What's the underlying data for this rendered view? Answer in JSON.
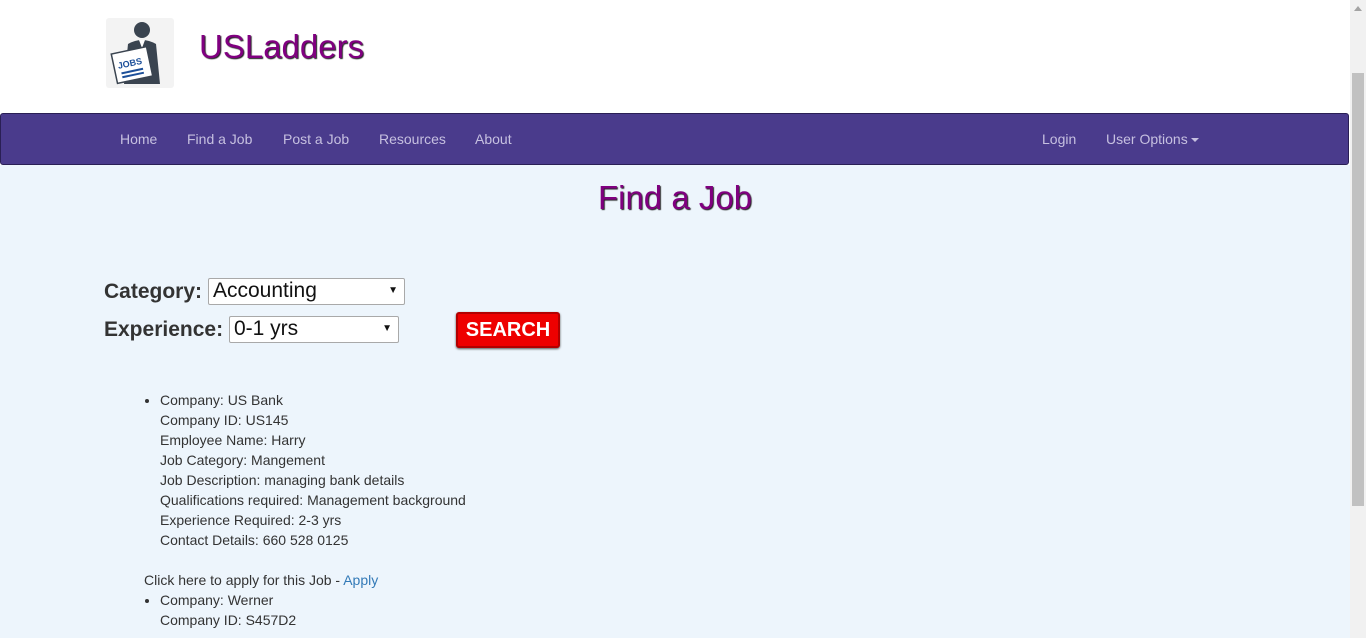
{
  "header": {
    "brand": "USLadders",
    "logo_text": "JOBS"
  },
  "nav": {
    "items": [
      "Home",
      "Find a Job",
      "Post a Job",
      "Resources",
      "About"
    ],
    "login": "Login",
    "user_options": "User Options"
  },
  "page": {
    "title": "Find a Job"
  },
  "filters": {
    "category_label": "Category:",
    "category_value": "Accounting",
    "experience_label": "Experience:",
    "experience_value": "0-1 yrs",
    "search_label": "SEARCH"
  },
  "jobs": [
    {
      "lines": [
        "Company: US Bank",
        "Company ID: US145",
        "Employee Name: Harry",
        "Job Category: Mangement",
        "Job Description: managing bank details",
        "Qualifications required: Management background",
        "Experience Required: 2-3 yrs",
        "Contact Details: 660 528 0125"
      ],
      "apply_prefix": "Click here to apply for this Job - ",
      "apply_link": "Apply"
    },
    {
      "lines": [
        "Company: Werner",
        "Company ID: S457D2"
      ]
    }
  ]
}
